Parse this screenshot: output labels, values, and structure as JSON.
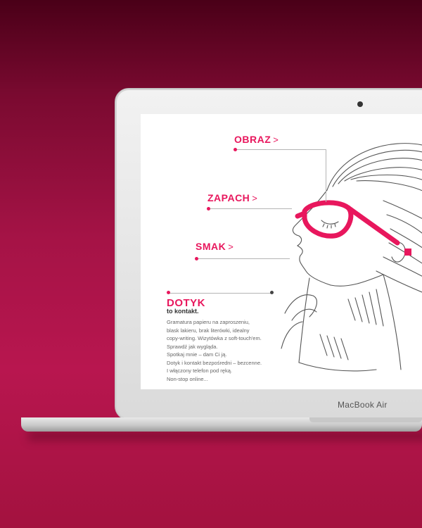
{
  "labels": {
    "obraz": "OBRAZ",
    "zapach": "ZAPACH",
    "smak": "SMAK",
    "dotyk": "DOTYK",
    "chevron": ">"
  },
  "dotyk_subtitle": "to kontakt.",
  "dotyk_text": [
    "Gramatura papieru na zaproszeniu,",
    "blask lakieru, brak literówki, idealny",
    "copy-writing. Wizytówka z soft-touch'em.",
    "Sprawdź jak wygląda.",
    "Spotkaj mnie – dam Ci ją.",
    "Dotyk i kontakt bezpośredni – bezcenne.",
    "I włączony telefon pod ręką.",
    "Non-stop online..."
  ],
  "device_brand": "MacBook Air",
  "colors": {
    "accent": "#e8175d",
    "background": "#a51346"
  },
  "icons": {
    "chevron": "chevron-right-icon",
    "illustration": "woman-with-glasses-illustration"
  }
}
